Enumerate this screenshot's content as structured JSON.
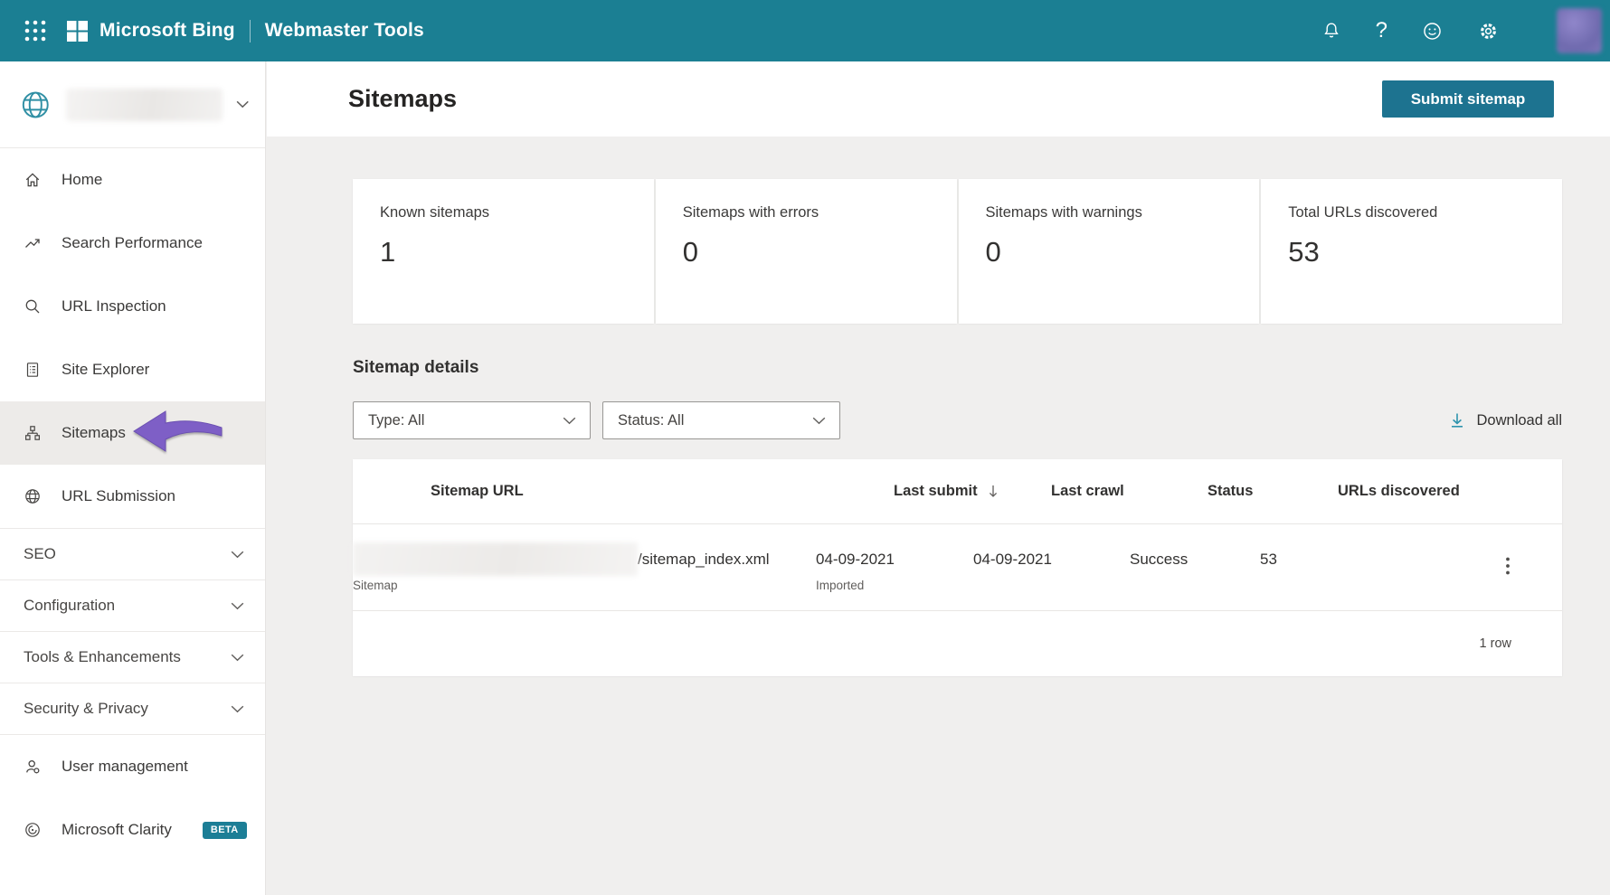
{
  "topbar": {
    "brand": "Microsoft Bing",
    "product": "Webmaster Tools"
  },
  "sidebar": {
    "items": [
      {
        "label": "Home"
      },
      {
        "label": "Search Performance"
      },
      {
        "label": "URL Inspection"
      },
      {
        "label": "Site Explorer"
      },
      {
        "label": "Sitemaps"
      },
      {
        "label": "URL Submission"
      }
    ],
    "sections": [
      {
        "label": "SEO"
      },
      {
        "label": "Configuration"
      },
      {
        "label": "Tools & Enhancements"
      },
      {
        "label": "Security & Privacy"
      }
    ],
    "footer_items": [
      {
        "label": "User management"
      },
      {
        "label": "Microsoft Clarity",
        "badge": "BETA"
      }
    ]
  },
  "header": {
    "title": "Sitemaps",
    "submit_button_label": "Submit sitemap"
  },
  "stats": {
    "cards": [
      {
        "label": "Known sitemaps",
        "value": "1"
      },
      {
        "label": "Sitemaps with errors",
        "value": "0"
      },
      {
        "label": "Sitemaps with warnings",
        "value": "0"
      },
      {
        "label": "Total URLs discovered",
        "value": "53"
      }
    ]
  },
  "details": {
    "heading": "Sitemap details",
    "type_filter": "Type: All",
    "status_filter": "Status: All",
    "download_label": "Download all"
  },
  "table": {
    "columns": {
      "url": "Sitemap URL",
      "last_submit": "Last submit",
      "last_crawl": "Last crawl",
      "status": "Status",
      "urls_discovered": "URLs discovered"
    },
    "row": {
      "url_visible_part": "/sitemap_index.xml",
      "type_label": "Sitemap",
      "last_submit": "04-09-2021",
      "last_submit_note": "Imported",
      "last_crawl": "04-09-2021",
      "status": "Success",
      "urls_discovered": "53"
    },
    "footer": "1 row"
  },
  "colors": {
    "topbar_teal": "#1b7f93",
    "button_teal": "#1d7390",
    "badge_teal": "#1c7e96",
    "annotation_arrow_purple": "#7e5fc6",
    "download_icon_teal": "#2e93ad",
    "sidebar_active_bg": "#edebe9"
  }
}
